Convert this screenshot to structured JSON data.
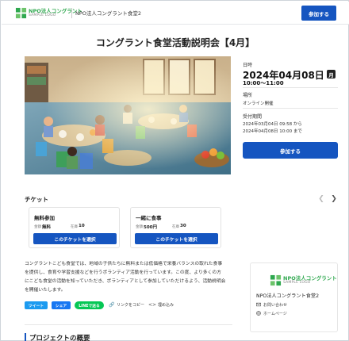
{
  "header": {
    "logo_name": "NPO法人コングラント",
    "logo_sub": "SAMPLE LOGO",
    "org_name": "NPO法人コングラント食堂2",
    "support_label": "参加する"
  },
  "page_title": "コングラント食堂活動説明会【4月】",
  "event": {
    "date_label": "日時",
    "date": "2024年04月08日",
    "weekday": "月",
    "time": "10:00～11:00",
    "venue_label": "場所",
    "venue": "オンライン開催",
    "period_label": "受付期間",
    "period_start": "2024年03月04日 09:58 から",
    "period_end": "2024年04月08日 10:00 まで",
    "join_label": "参加する"
  },
  "tickets": {
    "heading": "チケット",
    "price_label": "金額",
    "stock_label": "在庫",
    "items": [
      {
        "name": "無料参加",
        "price": "無料",
        "stock": "10",
        "button": "このチケットを選択"
      },
      {
        "name": "一緒に食事",
        "price": "500円",
        "stock": "30",
        "button": "このチケットを選択"
      }
    ]
  },
  "description": [
    "コングラントこども食堂では、地域の子供たちに無料または低価格で栄養バランスの取れた食事",
    "を提供し、食育や学習支援などを行うボランティア活動を行っています。この度、より多くの方",
    "にこども食堂の活動を知っていただき、ボランティアとして参加していただけるよう、活動説明会",
    "を開催いたします。"
  ],
  "share": {
    "tweet": "ツイート",
    "facebook": "シェア",
    "line": "LINEで送る",
    "copy_link": "リンクをコピー",
    "embed": "埋め込み"
  },
  "project_heading": "プロジェクトの概要",
  "org_card": {
    "logo_name": "NPO法人コングラント",
    "logo_sub": "SAMPLE LOGO",
    "name": "NPO法人コングラント食堂2",
    "contact": "お問い合わせ",
    "homepage": "ホームページ"
  },
  "colors": {
    "primary": "#1555c0",
    "brand_green": "#2fa84f",
    "twitter": "#1d9bf0",
    "facebook": "#1877f2",
    "line": "#06c755"
  }
}
